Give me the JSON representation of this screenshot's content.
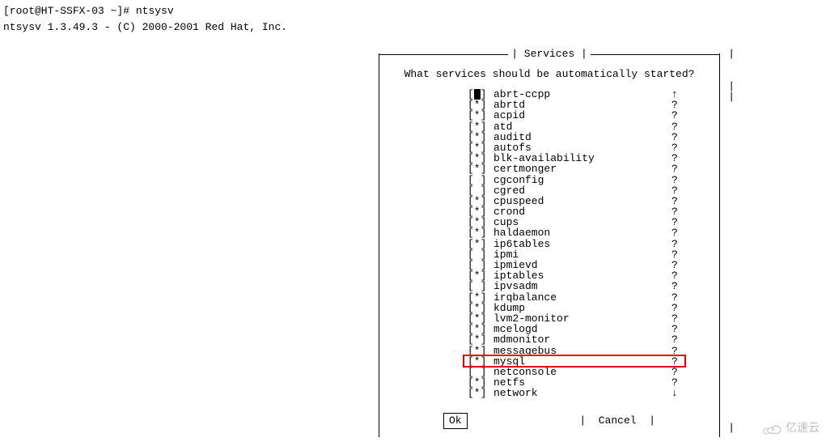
{
  "terminal": {
    "line1": "[root@HT-SSFX-03 ~]# ntsysv",
    "line2": "ntsysv 1.3.49.3 - (C) 2000-2001 Red Hat, Inc."
  },
  "dialog": {
    "title": "| Services |",
    "prompt": "What services should be automatically started?",
    "ok_label": "Ok",
    "cancel_label": "|  Cancel  |"
  },
  "services": [
    {
      "check": "[*]",
      "name": "abrt-ccpp",
      "help": "↑",
      "selected": true
    },
    {
      "check": "[*]",
      "name": "abrtd",
      "help": "?",
      "selected": false
    },
    {
      "check": "[*]",
      "name": "acpid",
      "help": "?",
      "selected": false
    },
    {
      "check": "[*]",
      "name": "atd",
      "help": "?",
      "selected": false
    },
    {
      "check": "[*]",
      "name": "auditd",
      "help": "?",
      "selected": false
    },
    {
      "check": "[*]",
      "name": "autofs",
      "help": "?",
      "selected": false
    },
    {
      "check": "[*]",
      "name": "blk-availability",
      "help": "?",
      "selected": false
    },
    {
      "check": "[*]",
      "name": "certmonger",
      "help": "?",
      "selected": false
    },
    {
      "check": "[ ]",
      "name": "cgconfig",
      "help": "?",
      "selected": false
    },
    {
      "check": "[ ]",
      "name": "cgred",
      "help": "?",
      "selected": false
    },
    {
      "check": "[*]",
      "name": "cpuspeed",
      "help": "?",
      "selected": false
    },
    {
      "check": "[*]",
      "name": "crond",
      "help": "?",
      "selected": false
    },
    {
      "check": "[*]",
      "name": "cups",
      "help": "?",
      "selected": false
    },
    {
      "check": "[*]",
      "name": "haldaemon",
      "help": "?",
      "selected": false
    },
    {
      "check": "[*]",
      "name": "ip6tables",
      "help": "?",
      "selected": false
    },
    {
      "check": "[ ]",
      "name": "ipmi",
      "help": "?",
      "selected": false
    },
    {
      "check": "[ ]",
      "name": "ipmievd",
      "help": "?",
      "selected": false
    },
    {
      "check": "[*]",
      "name": "iptables",
      "help": "?",
      "selected": false
    },
    {
      "check": "[ ]",
      "name": "ipvsadm",
      "help": "?",
      "selected": false
    },
    {
      "check": "[*]",
      "name": "irqbalance",
      "help": "?",
      "selected": false
    },
    {
      "check": "[*]",
      "name": "kdump",
      "help": "?",
      "selected": false
    },
    {
      "check": "[*]",
      "name": "lvm2-monitor",
      "help": "?",
      "selected": false
    },
    {
      "check": "[*]",
      "name": "mcelogd",
      "help": "?",
      "selected": false
    },
    {
      "check": "[*]",
      "name": "mdmonitor",
      "help": "?",
      "selected": false
    },
    {
      "check": "[*]",
      "name": "messagebus",
      "help": "?",
      "selected": false
    },
    {
      "check": "[*]",
      "name": "mysql",
      "help": "?",
      "selected": false,
      "highlighted": true
    },
    {
      "check": "[ ]",
      "name": "netconsole",
      "help": "?",
      "selected": false
    },
    {
      "check": "[*]",
      "name": "netfs",
      "help": "?",
      "selected": false
    },
    {
      "check": "[*]",
      "name": "network",
      "help": "↓",
      "selected": false
    }
  ],
  "outer_pipes": [
    "|",
    "",
    "",
    "|",
    "|",
    "",
    "",
    "",
    "",
    "",
    "",
    "",
    "",
    "",
    "",
    "",
    "",
    "",
    "",
    "",
    "",
    "",
    "",
    "",
    "",
    "",
    "",
    "",
    "",
    "",
    "",
    "",
    "",
    "",
    "",
    "|"
  ],
  "watermark": "亿速云"
}
